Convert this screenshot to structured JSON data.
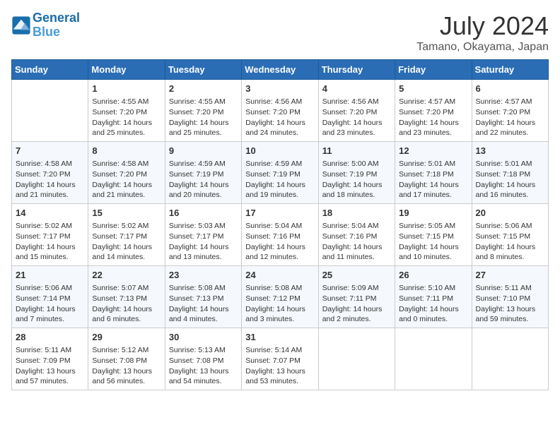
{
  "header": {
    "logo_line1": "General",
    "logo_line2": "Blue",
    "month": "July 2024",
    "location": "Tamano, Okayama, Japan"
  },
  "weekdays": [
    "Sunday",
    "Monday",
    "Tuesday",
    "Wednesday",
    "Thursday",
    "Friday",
    "Saturday"
  ],
  "weeks": [
    [
      {
        "day": "",
        "info": ""
      },
      {
        "day": "1",
        "info": "Sunrise: 4:55 AM\nSunset: 7:20 PM\nDaylight: 14 hours\nand 25 minutes."
      },
      {
        "day": "2",
        "info": "Sunrise: 4:55 AM\nSunset: 7:20 PM\nDaylight: 14 hours\nand 25 minutes."
      },
      {
        "day": "3",
        "info": "Sunrise: 4:56 AM\nSunset: 7:20 PM\nDaylight: 14 hours\nand 24 minutes."
      },
      {
        "day": "4",
        "info": "Sunrise: 4:56 AM\nSunset: 7:20 PM\nDaylight: 14 hours\nand 23 minutes."
      },
      {
        "day": "5",
        "info": "Sunrise: 4:57 AM\nSunset: 7:20 PM\nDaylight: 14 hours\nand 23 minutes."
      },
      {
        "day": "6",
        "info": "Sunrise: 4:57 AM\nSunset: 7:20 PM\nDaylight: 14 hours\nand 22 minutes."
      }
    ],
    [
      {
        "day": "7",
        "info": "Sunrise: 4:58 AM\nSunset: 7:20 PM\nDaylight: 14 hours\nand 21 minutes."
      },
      {
        "day": "8",
        "info": "Sunrise: 4:58 AM\nSunset: 7:20 PM\nDaylight: 14 hours\nand 21 minutes."
      },
      {
        "day": "9",
        "info": "Sunrise: 4:59 AM\nSunset: 7:19 PM\nDaylight: 14 hours\nand 20 minutes."
      },
      {
        "day": "10",
        "info": "Sunrise: 4:59 AM\nSunset: 7:19 PM\nDaylight: 14 hours\nand 19 minutes."
      },
      {
        "day": "11",
        "info": "Sunrise: 5:00 AM\nSunset: 7:19 PM\nDaylight: 14 hours\nand 18 minutes."
      },
      {
        "day": "12",
        "info": "Sunrise: 5:01 AM\nSunset: 7:18 PM\nDaylight: 14 hours\nand 17 minutes."
      },
      {
        "day": "13",
        "info": "Sunrise: 5:01 AM\nSunset: 7:18 PM\nDaylight: 14 hours\nand 16 minutes."
      }
    ],
    [
      {
        "day": "14",
        "info": "Sunrise: 5:02 AM\nSunset: 7:17 PM\nDaylight: 14 hours\nand 15 minutes."
      },
      {
        "day": "15",
        "info": "Sunrise: 5:02 AM\nSunset: 7:17 PM\nDaylight: 14 hours\nand 14 minutes."
      },
      {
        "day": "16",
        "info": "Sunrise: 5:03 AM\nSunset: 7:17 PM\nDaylight: 14 hours\nand 13 minutes."
      },
      {
        "day": "17",
        "info": "Sunrise: 5:04 AM\nSunset: 7:16 PM\nDaylight: 14 hours\nand 12 minutes."
      },
      {
        "day": "18",
        "info": "Sunrise: 5:04 AM\nSunset: 7:16 PM\nDaylight: 14 hours\nand 11 minutes."
      },
      {
        "day": "19",
        "info": "Sunrise: 5:05 AM\nSunset: 7:15 PM\nDaylight: 14 hours\nand 10 minutes."
      },
      {
        "day": "20",
        "info": "Sunrise: 5:06 AM\nSunset: 7:15 PM\nDaylight: 14 hours\nand 8 minutes."
      }
    ],
    [
      {
        "day": "21",
        "info": "Sunrise: 5:06 AM\nSunset: 7:14 PM\nDaylight: 14 hours\nand 7 minutes."
      },
      {
        "day": "22",
        "info": "Sunrise: 5:07 AM\nSunset: 7:13 PM\nDaylight: 14 hours\nand 6 minutes."
      },
      {
        "day": "23",
        "info": "Sunrise: 5:08 AM\nSunset: 7:13 PM\nDaylight: 14 hours\nand 4 minutes."
      },
      {
        "day": "24",
        "info": "Sunrise: 5:08 AM\nSunset: 7:12 PM\nDaylight: 14 hours\nand 3 minutes."
      },
      {
        "day": "25",
        "info": "Sunrise: 5:09 AM\nSunset: 7:11 PM\nDaylight: 14 hours\nand 2 minutes."
      },
      {
        "day": "26",
        "info": "Sunrise: 5:10 AM\nSunset: 7:11 PM\nDaylight: 14 hours\nand 0 minutes."
      },
      {
        "day": "27",
        "info": "Sunrise: 5:11 AM\nSunset: 7:10 PM\nDaylight: 13 hours\nand 59 minutes."
      }
    ],
    [
      {
        "day": "28",
        "info": "Sunrise: 5:11 AM\nSunset: 7:09 PM\nDaylight: 13 hours\nand 57 minutes."
      },
      {
        "day": "29",
        "info": "Sunrise: 5:12 AM\nSunset: 7:08 PM\nDaylight: 13 hours\nand 56 minutes."
      },
      {
        "day": "30",
        "info": "Sunrise: 5:13 AM\nSunset: 7:08 PM\nDaylight: 13 hours\nand 54 minutes."
      },
      {
        "day": "31",
        "info": "Sunrise: 5:14 AM\nSunset: 7:07 PM\nDaylight: 13 hours\nand 53 minutes."
      },
      {
        "day": "",
        "info": ""
      },
      {
        "day": "",
        "info": ""
      },
      {
        "day": "",
        "info": ""
      }
    ]
  ]
}
